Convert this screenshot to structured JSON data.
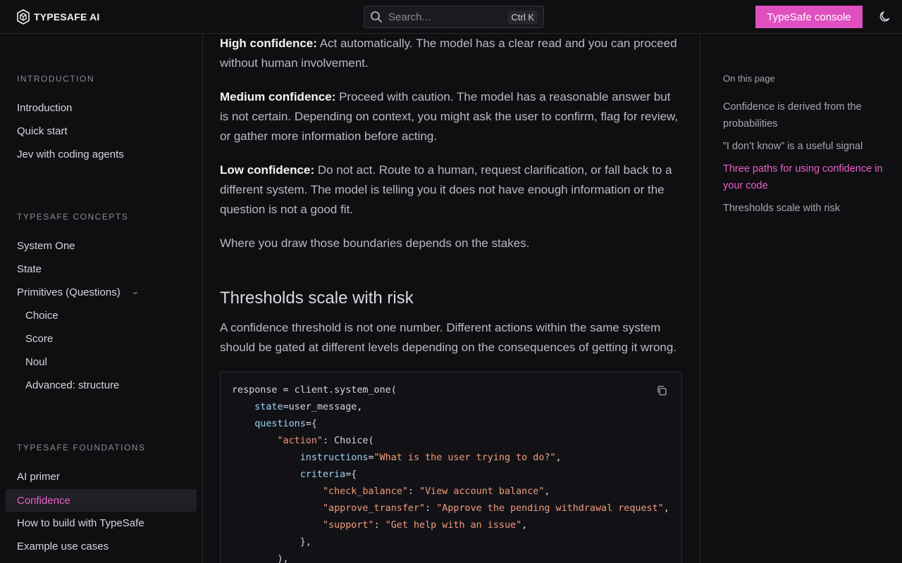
{
  "header": {
    "logo_text": "TYPESAFE AI",
    "search_placeholder": "Search...",
    "search_shortcut": "Ctrl K",
    "console_button": "TypeSafe console",
    "accent_color": "#e04fbf"
  },
  "sidebar": {
    "sections": [
      {
        "title": "INTRODUCTION",
        "items": [
          "Introduction",
          "Quick start",
          "Jev with coding agents"
        ]
      },
      {
        "title": "TYPESAFE CONCEPTS",
        "items": [
          "System One",
          "State",
          "Primitives (Questions)"
        ],
        "subitems": [
          "Choice",
          "Score",
          "Noul",
          "Advanced: structure"
        ]
      },
      {
        "title": "TYPESAFE FOUNDATIONS",
        "items": [
          "AI primer",
          "Confidence",
          "How to build with TypeSafe",
          "Example use cases"
        ]
      }
    ],
    "active_item": "Confidence"
  },
  "main": {
    "high": {
      "label": "High confidence:",
      "text": " Act automatically. The model has a clear read and you can proceed without human involvement."
    },
    "medium": {
      "label": "Medium confidence:",
      "text": " Proceed with caution. The model has a reasonable answer but is not certain. Depending on context, you might ask the user to confirm, flag for review, or gather more information before acting."
    },
    "low": {
      "label": "Low confidence:",
      "text": " Do not act. Route to a human, request clarification, or fall back to a different system. The model is telling you it does not have enough information or the question is not a good fit."
    },
    "boundaries": "Where you draw those boundaries depends on the stakes.",
    "heading": "Thresholds scale with risk",
    "threshold_text": "A confidence threshold is not one number. Different actions within the same system should be gated at different levels depending on the consequences of getting it wrong."
  },
  "code": {
    "line1": "response = client.system_one(",
    "state_kw": "state",
    "state_val": "=user_message,",
    "questions_kw": "questions",
    "questions_val": "={",
    "action_key": "\"action\"",
    "action_val": ": Choice(",
    "instructions_kw": "instructions",
    "instructions_eq": "=",
    "instructions_str": "\"What is the user trying to do?\"",
    "instructions_end": ",",
    "criteria_kw": "criteria",
    "criteria_val": "={",
    "c1_key": "\"check_balance\"",
    "c1_sep": ": ",
    "c1_val": "\"View account balance\"",
    "c2_key": "\"approve_transfer\"",
    "c2_sep": ": ",
    "c2_val": "\"Approve the pending withdrawal request\"",
    "c3_key": "\"support\"",
    "c3_sep": ": ",
    "c3_val": "\"Get help with an issue\"",
    "close1": "},",
    "close2": "),"
  },
  "toc": {
    "title": "On this page",
    "items": [
      "Confidence is derived from the probabilities",
      "”I don’t know” is a useful signal",
      "Three paths for using confidence in your code",
      "Thresholds scale with risk"
    ],
    "active_index": 2
  }
}
